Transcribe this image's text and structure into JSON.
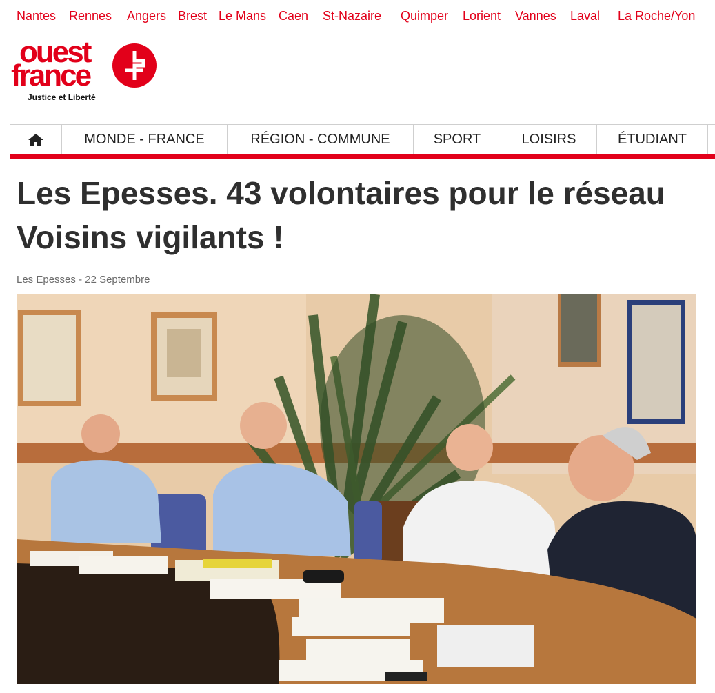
{
  "cities": [
    "Nantes",
    "Rennes",
    "Angers",
    "Brest",
    "Le Mans",
    "Caen",
    "St-Nazaire",
    "Quimper",
    "Lorient",
    "Vannes",
    "Laval",
    "La Roche/Yon"
  ],
  "logo": {
    "word1": "ouest",
    "word2": "france",
    "slogan": "Justice et Liberté",
    "brand_color": "#e2001a"
  },
  "nav": {
    "home_icon": "home-icon",
    "items": [
      "MONDE - FRANCE",
      "RÉGION - COMMUNE",
      "SPORT",
      "LOISIRS",
      "ÉTUDIANT"
    ]
  },
  "article": {
    "title": "Les Epesses. 43 volontaires pour le réseau Voisins vigilants !",
    "location": "Les Epesses",
    "separator": "-",
    "date": "22 Septembre"
  }
}
